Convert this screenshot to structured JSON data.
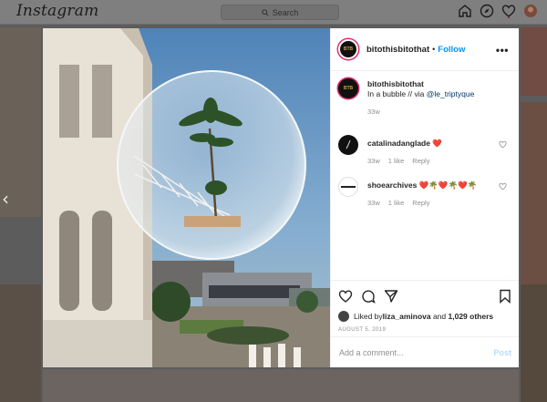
{
  "app": {
    "logo": "Instagram"
  },
  "search": {
    "placeholder": "Search"
  },
  "nav": {
    "icons": [
      "home-icon",
      "explore-icon",
      "heart-icon",
      "profile-avatar"
    ]
  },
  "post": {
    "author": "bitothisbitothat",
    "separator": "•",
    "follow_label": "Follow",
    "more_label": "•••",
    "caption": {
      "username": "bitothisbitothat",
      "text_prefix": "In a bubble // via ",
      "mention": "@le_triptyque",
      "time": "33w"
    },
    "comments": [
      {
        "username": "catalinadanglade",
        "text": "❤️",
        "time": "33w",
        "likes": "1 like",
        "reply": "Reply"
      },
      {
        "username": "shoearchives",
        "text": "❤️🌴❤️🌴❤️🌴",
        "time": "33w",
        "likes": "1 like",
        "reply": "Reply"
      }
    ],
    "likes": {
      "prefix": "Liked by ",
      "user": "liza_aminova",
      "middle": " and ",
      "others": "1,029 others"
    },
    "date": "AUGUST 5, 2019",
    "add_comment_placeholder": "Add a comment...",
    "post_button": "Post",
    "avatar_text": "BTB"
  },
  "colors": {
    "accent": "#0095f6",
    "heart": "#ed4956",
    "story_ring": "#e0306c"
  }
}
